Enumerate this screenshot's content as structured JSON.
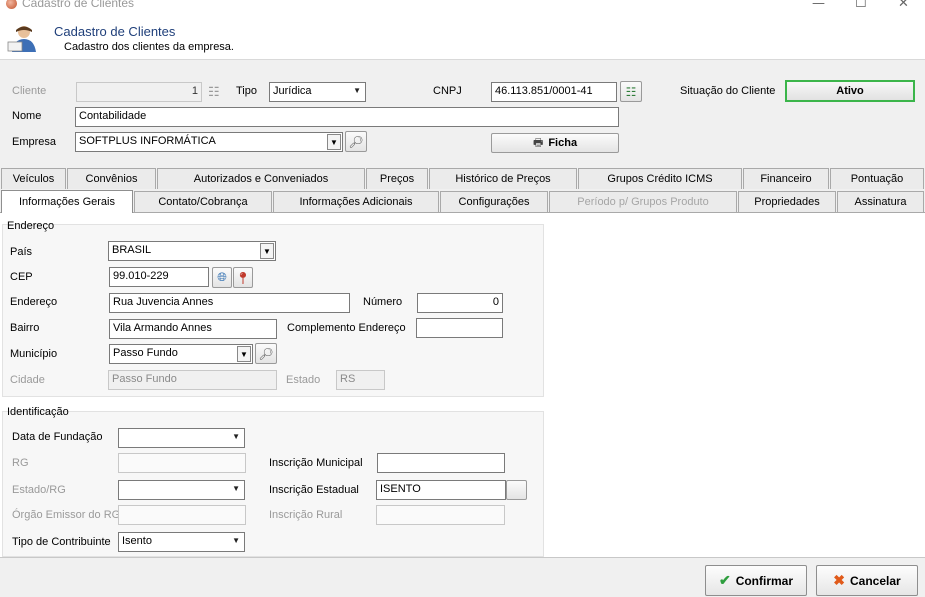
{
  "window": {
    "title": "Cadastro de Clientes"
  },
  "header": {
    "title": "Cadastro de Clientes",
    "subtitle": "Cadastro dos clientes da empresa."
  },
  "form": {
    "cliente_label": "Cliente",
    "cliente_value": "1",
    "tipo_label": "Tipo",
    "tipo_value": "Jurídica",
    "cnpj_label": "CNPJ",
    "cnpj_value": "46.113.851/0001-41",
    "situacao_label": "Situação do Cliente",
    "situacao_value": "Ativo",
    "nome_label": "Nome",
    "nome_value": "Contabilidade",
    "empresa_label": "Empresa",
    "empresa_value": "SOFTPLUS INFORMÁTICA",
    "ficha_label": "Ficha"
  },
  "tabs_row1": [
    "Veículos",
    "Convênios",
    "Autorizados e Conveniados",
    "Preços",
    "Histórico de Preços",
    "Grupos Crédito ICMS",
    "Financeiro",
    "Pontuação"
  ],
  "tabs_row2": [
    "Informações Gerais",
    "Contato/Cobrança",
    "Informações Adicionais",
    "Configurações",
    "Período p/ Grupos Produto",
    "Propriedades",
    "Assinatura"
  ],
  "endereco": {
    "group_title": "Endereço",
    "pais_label": "País",
    "pais_value": "BRASIL",
    "cep_label": "CEP",
    "cep_value": "99.010-229",
    "endereco_label": "Endereço",
    "endereco_value": "Rua Juvencia Annes",
    "numero_label": "Número",
    "numero_value": "0",
    "bairro_label": "Bairro",
    "bairro_value": "Vila Armando Annes",
    "complemento_label": "Complemento Endereço",
    "complemento_value": "",
    "municipio_label": "Município",
    "municipio_value": "Passo Fundo",
    "cidade_label": "Cidade",
    "cidade_value": "Passo Fundo",
    "estado_label": "Estado",
    "estado_value": "RS"
  },
  "identificacao": {
    "group_title": "Identificação",
    "data_fundacao_label": "Data de Fundação",
    "data_fundacao_value": "",
    "rg_label": "RG",
    "rg_value": "",
    "insc_municipal_label": "Inscrição Municipal",
    "insc_municipal_value": "",
    "estado_rg_label": "Estado/RG",
    "estado_rg_value": "",
    "insc_estadual_label": "Inscrição Estadual",
    "insc_estadual_value": "ISENTO",
    "orgao_emissor_label": "Órgão Emissor do RG",
    "orgao_emissor_value": "",
    "insc_rural_label": "Inscrição Rural",
    "insc_rural_value": "",
    "tipo_contribuinte_label": "Tipo de Contribuinte",
    "tipo_contribuinte_value": "Isento"
  },
  "footer": {
    "confirmar_label": "Confirmar",
    "cancelar_label": "Cancelar"
  },
  "colors": {
    "header_title": "#1f3f7a",
    "status_border": "#3bb54a",
    "confirm_icon": "#2e9e3e",
    "cancel_icon": "#e05a1a"
  },
  "icons": [
    "app-icon",
    "user-icon",
    "sequence-icon",
    "cnpj-lookup-icon",
    "search-icon",
    "printer-icon",
    "globe-icon",
    "map-pin-icon",
    "check-icon",
    "cancel-x-icon"
  ]
}
